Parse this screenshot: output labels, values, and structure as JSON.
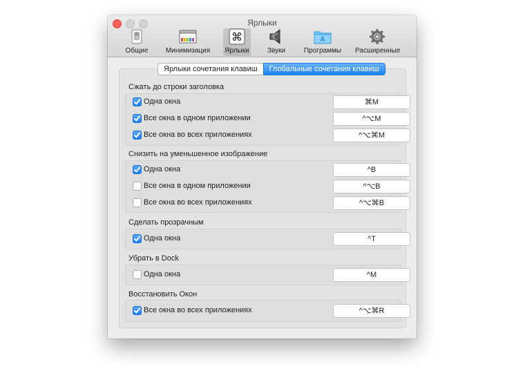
{
  "window": {
    "title": "Ярлыки"
  },
  "toolbar": {
    "items": [
      {
        "label": "Общие",
        "icon": "general-switch-icon"
      },
      {
        "label": "Минимизация",
        "icon": "minimize-window-icon"
      },
      {
        "label": "Ярлыки",
        "icon": "command-key-icon",
        "selected": true
      },
      {
        "label": "Звуки",
        "icon": "speaker-icon"
      },
      {
        "label": "Программы",
        "icon": "applications-folder-icon"
      },
      {
        "label": "Расширенные",
        "icon": "gear-icon"
      }
    ]
  },
  "tabs": [
    {
      "label": "Ярлыки сочетания клавиш",
      "selected": false
    },
    {
      "label": "Глобальные сочетания клавиш",
      "selected": true
    }
  ],
  "sections": [
    {
      "title": "Сжать до строки заголовка",
      "rows": [
        {
          "label": "Одна окна",
          "checked": true,
          "shortcut": "⌘M"
        },
        {
          "label": "Все окна в одном приложении",
          "checked": true,
          "shortcut": "^⌥M"
        },
        {
          "label": "Все окна во всех приложениях",
          "checked": true,
          "shortcut": "^⌥⌘M"
        }
      ]
    },
    {
      "title": "Снизить на уменьшенное изображение",
      "rows": [
        {
          "label": "Одна окна",
          "checked": true,
          "shortcut": "^B"
        },
        {
          "label": "Все окна в одном приложении",
          "checked": false,
          "shortcut": "^⌥B"
        },
        {
          "label": "Все окна во всех приложениях",
          "checked": false,
          "shortcut": "^⌥⌘B"
        }
      ]
    },
    {
      "title": "Сделать прозрачным",
      "rows": [
        {
          "label": "Одна окна",
          "checked": true,
          "shortcut": "^T"
        }
      ]
    },
    {
      "title": "Убрать в Dock",
      "rows": [
        {
          "label": "Одна окна",
          "checked": false,
          "shortcut": "^M"
        }
      ]
    },
    {
      "title": "Восстановить Окон",
      "rows": [
        {
          "label": "Все окна во всех приложениях",
          "checked": true,
          "shortcut": "^⌥⌘R"
        }
      ]
    }
  ],
  "colors": {
    "accent": "#1b82f1",
    "close": "#ff5f57"
  }
}
